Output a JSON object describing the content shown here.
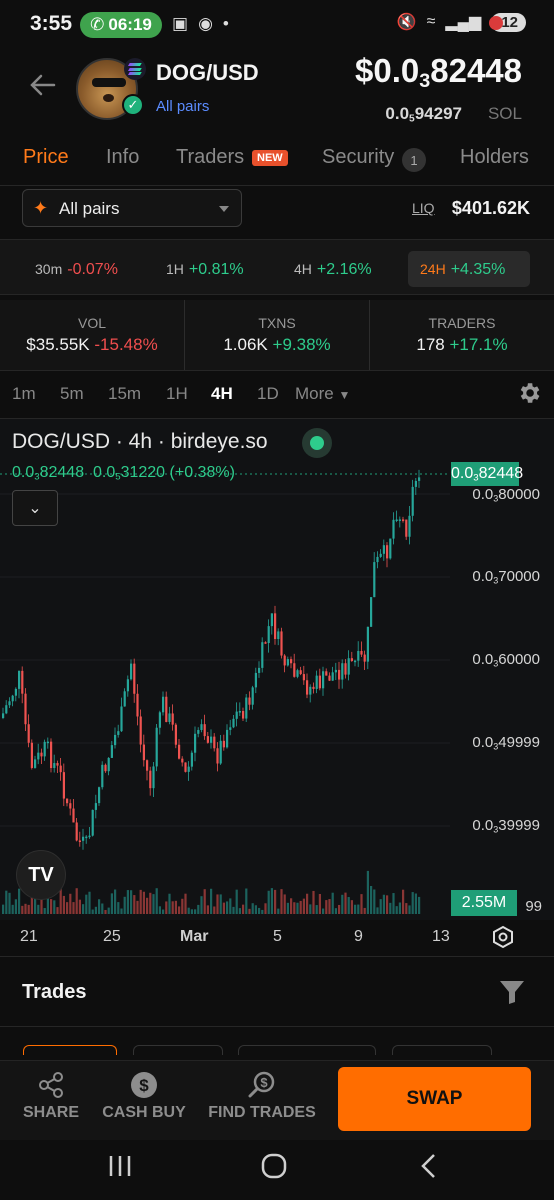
{
  "status_bar": {
    "time": "3:55",
    "call_duration": "06:19",
    "battery": "12"
  },
  "header": {
    "pair": "DOG/USD",
    "all_pairs_link": "All pairs",
    "price_prefix": "$0.0",
    "price_sub": "3",
    "price_rest": "82448",
    "sol_prefix": "0.0",
    "sol_sub": "5",
    "sol_rest": "94297",
    "sol_unit": "SOL"
  },
  "tabs": [
    {
      "label": "Price",
      "active": true
    },
    {
      "label": "Info"
    },
    {
      "label": "Traders",
      "badge": "NEW"
    },
    {
      "label": "Security",
      "count": "1"
    },
    {
      "label": "Holders"
    }
  ],
  "pair_selector": {
    "label": "All pairs"
  },
  "liquidity": {
    "label": "LIQ",
    "value": "$401.62K"
  },
  "changes": [
    {
      "period": "30m",
      "value": "-0.07%",
      "direction": "down"
    },
    {
      "period": "1H",
      "value": "+0.81%",
      "direction": "up"
    },
    {
      "period": "4H",
      "value": "+2.16%",
      "direction": "up"
    },
    {
      "period": "24H",
      "value": "+4.35%",
      "direction": "up",
      "selected": true
    }
  ],
  "stats": [
    {
      "label": "VOL",
      "value": "$35.55K",
      "change": "-15.48%",
      "direction": "down"
    },
    {
      "label": "TXNS",
      "value": "1.06K",
      "change": "+9.38%",
      "direction": "up"
    },
    {
      "label": "TRADERS",
      "value": "178",
      "change": "+17.1%",
      "direction": "up"
    }
  ],
  "timeframes": {
    "items": [
      "1m",
      "5m",
      "15m",
      "1H",
      "4H",
      "1D"
    ],
    "active": "4H",
    "more": "More"
  },
  "chart": {
    "title": "DOG/USD · 4h · birdeye.so",
    "ohlc_last_prefix": "0.0",
    "ohlc_last_sub": "3",
    "ohlc_last_rest": "82448",
    "ohlc_change_prefix": "0.0",
    "ohlc_change_sub": "5",
    "ohlc_change_rest": "31220",
    "ohlc_change_pct": "(+0.38%)",
    "price_tag_prefix": "0.0",
    "price_tag_sub": "3",
    "price_tag_rest": "82448",
    "volume_tag": "2.55M",
    "y_axis": [
      {
        "prefix": "0.0",
        "sub": "3",
        "rest": "80000"
      },
      {
        "prefix": "0.0",
        "sub": "3",
        "rest": "70000"
      },
      {
        "prefix": "0.0",
        "sub": "3",
        "rest": "60000"
      },
      {
        "prefix": "0.0",
        "sub": "3",
        "rest": "49999"
      },
      {
        "prefix": "0.0",
        "sub": "3",
        "rest": "39999"
      }
    ],
    "y_axis_partial": "99",
    "x_axis": [
      "21",
      "25",
      "Mar",
      "5",
      "9",
      "13"
    ],
    "colors": {
      "up": "#26a69a",
      "down": "#ef5350"
    }
  },
  "trades": {
    "title": "Trades"
  },
  "bottom_bar": {
    "share": "SHARE",
    "cash_buy": "CASH BUY",
    "find_trades": "FIND TRADES",
    "swap": "SWAP"
  },
  "colors": {
    "accent": "#ff6d00",
    "positive": "#2ecc8c",
    "negative": "#ef4e4e"
  }
}
